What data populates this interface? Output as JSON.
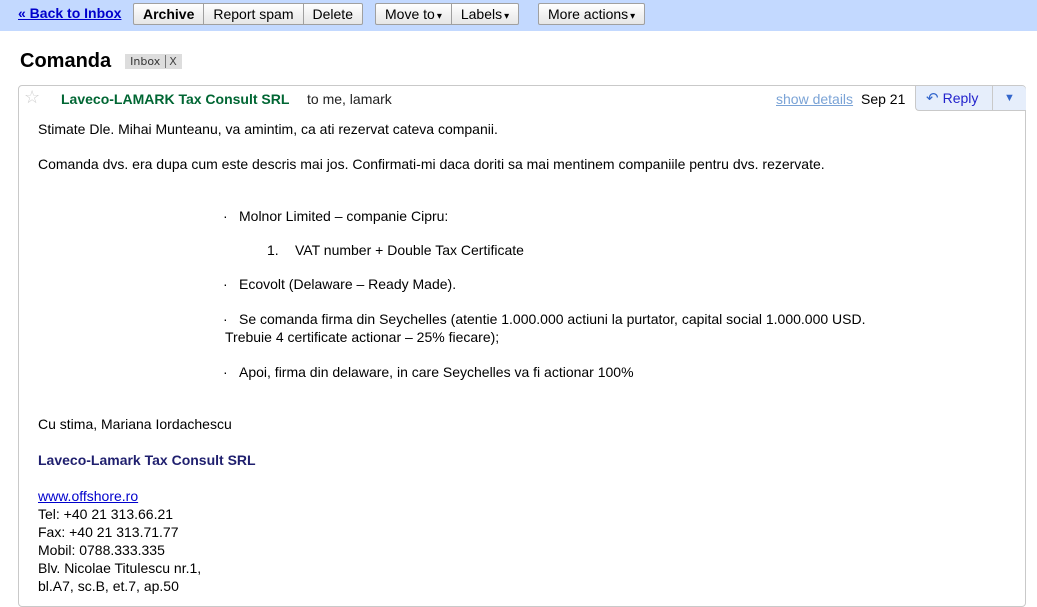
{
  "toolbar": {
    "back_label": "« Back to Inbox",
    "archive": "Archive",
    "report_spam": "Report spam",
    "delete": "Delete",
    "move_to": "Move to",
    "labels": "Labels",
    "more_actions": "More actions",
    "caret": "▾"
  },
  "thread": {
    "subject": "Comanda",
    "label": "Inbox",
    "label_remove": "X"
  },
  "message": {
    "star": "☆",
    "sender": "Laveco-LAMARK Tax Consult SRL",
    "recipients": "to me, lamark",
    "show_details": "show details",
    "date": "Sep 21",
    "reply": "Reply",
    "reply_arrow": "↶",
    "reply_more": "▼",
    "greeting": "Stimate Dle. Mihai Munteanu, va amintim, ca ati rezervat cateva companii.",
    "intro": "Comanda dvs. era dupa cum este descris mai jos. Confirmati-mi daca doriti sa mai mentinem companiile pentru dvs. rezervate.",
    "bullet_char": "·",
    "items": [
      "Molnor Limited – companie Cipru:",
      "Ecovolt (Delaware – Ready Made).",
      "Se comanda firma din Seychelles (atentie 1.000.000 actiuni la purtator, capital social 1.000.000 USD.",
      "Apoi, firma din delaware, in care Seychelles va fi actionar 100%"
    ],
    "item3_cont": "Trebuie 4 certificate actionar – 25% fiecare);",
    "subitem_number": "1.",
    "subitem": "VAT number + Double Tax Certificate",
    "closing": "Cu stima, Mariana Iordachescu",
    "signature": {
      "company": "Laveco-Lamark Tax Consult SRL",
      "website": "www.offshore.ro",
      "tel": "Tel: +40 21 313.66.21",
      "fax": "Fax: +40 21 313.71.77",
      "mobil": "Mobil: 0788.333.335",
      "address1": "Blv. Nicolae Titulescu nr.1,",
      "address2": "bl.A7, sc.B, et.7, ap.50"
    }
  }
}
